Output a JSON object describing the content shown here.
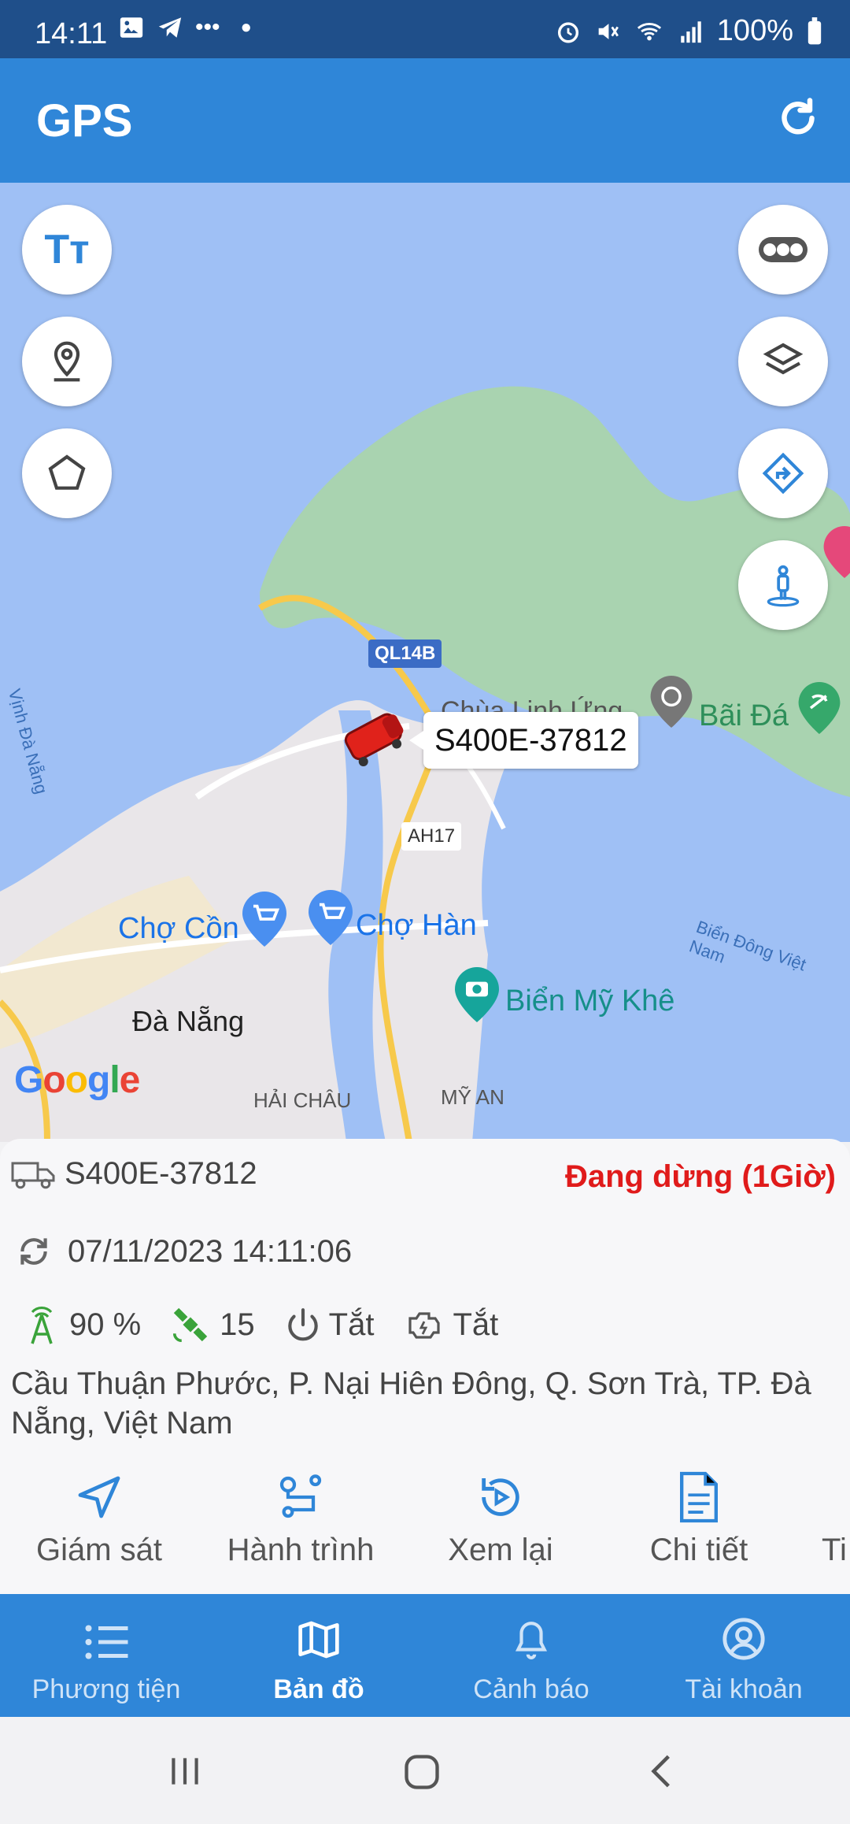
{
  "status_bar": {
    "time": "14:11",
    "battery": "100%"
  },
  "app_bar": {
    "title": "GPS"
  },
  "map": {
    "vehicle_label": "S400E-37812",
    "labels": {
      "ql14b": "QL14B",
      "ah17": "AH17",
      "cho_con": "Chợ Cồn",
      "cho_han": "Chợ Hàn",
      "da_nang": "Đà Nẵng",
      "bien_my_khe": "Biển Mỹ Khê",
      "bai_da": "Bãi Đá",
      "chua_linh_ung": "Chùa Linh Ứng",
      "hai_chau": "HẢI CHÂU",
      "my_an": "MỸ AN",
      "vinh_da_nang": "Vịnh Đà Nẵng",
      "bien_dong": "Biển Đông Việt Nam",
      "google": "Google"
    }
  },
  "vehicle": {
    "plate": "S400E-37812",
    "status": "Đang dừng (1Giờ)",
    "timestamp": "07/11/2023 14:11:06",
    "signal": "90 %",
    "satellites": "15",
    "power": "Tắt",
    "engine": "Tắt",
    "address": "Cầu Thuận Phước, P. Nại Hiên Đông, Q. Sơn Trà, TP. Đà Nẵng, Việt Nam"
  },
  "actions": [
    {
      "label": "Giám sát"
    },
    {
      "label": "Hành trình"
    },
    {
      "label": "Xem lại"
    },
    {
      "label": "Chi tiết"
    },
    {
      "label": "Ti"
    }
  ],
  "bottom_nav": [
    {
      "label": "Phương tiện"
    },
    {
      "label": "Bản đồ"
    },
    {
      "label": "Cảnh báo"
    },
    {
      "label": "Tài khoản"
    }
  ],
  "colors": {
    "primary": "#2f86d8",
    "status_bar": "#1f4f8a",
    "stopped": "#e01b1b",
    "water": "#9fc0f5",
    "land": "#a9d3b0"
  }
}
